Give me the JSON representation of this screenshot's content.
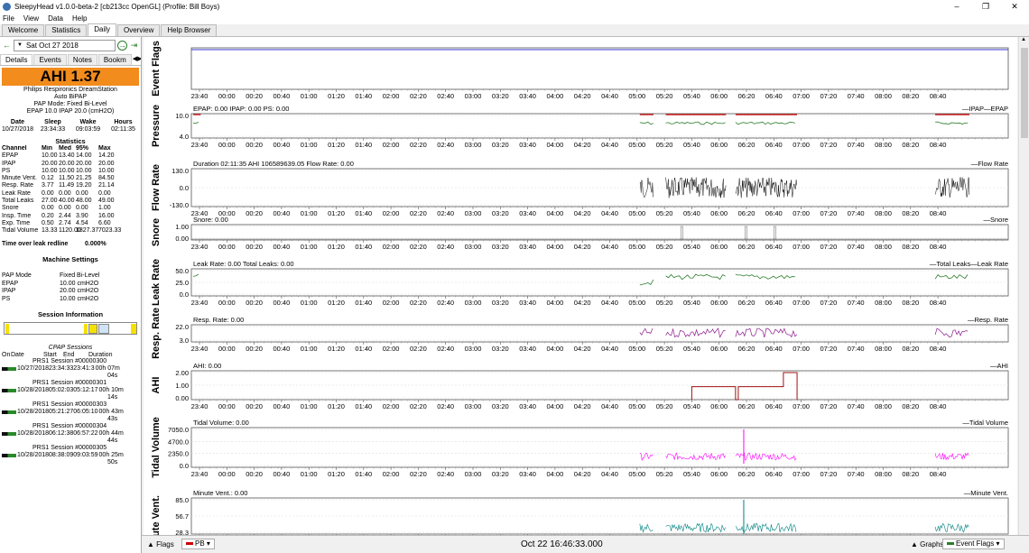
{
  "window": {
    "title": "SleepyHead v1.0.0-beta-2 [cb213cc OpenGL] (Profile: Bill Boys)",
    "minimize": "–",
    "maximize": "❐",
    "close": "✕"
  },
  "menu": [
    "File",
    "View",
    "Data",
    "Help"
  ],
  "tabs": [
    {
      "label": "Welcome",
      "active": false
    },
    {
      "label": "Statistics",
      "active": false
    },
    {
      "label": "Daily",
      "active": true
    },
    {
      "label": "Overview",
      "active": false
    },
    {
      "label": "Help Browser",
      "active": false
    }
  ],
  "left": {
    "date": "Sat Oct 27 2018",
    "subtabs": [
      "Details",
      "Events",
      "Notes",
      "Bookm"
    ],
    "ahi": "AHI 1.37",
    "machine": [
      "Philips Respironics DreamStation",
      "Auto BiPAP",
      "PAP Mode: Fixed Bi-Level",
      "EPAP 10.0 IPAP 20.0 (cmH2O)"
    ],
    "times": {
      "headers": [
        "Date",
        "Sleep",
        "Wake",
        "Hours"
      ],
      "values": [
        "10/27/2018",
        "23:34:33",
        "09:03:59",
        "02:11:35"
      ]
    },
    "stats_title": "Statistics",
    "stats_headers": [
      "Channel",
      "Min",
      "Med",
      "95%",
      "Max"
    ],
    "stats": [
      [
        "EPAP",
        "10.00",
        "13.40",
        "14.00",
        "14.20"
      ],
      [
        "IPAP",
        "20.00",
        "20.00",
        "20.00",
        "20.00"
      ],
      [
        "PS",
        "10.00",
        "10.00",
        "10.00",
        "10.00"
      ],
      [
        "Minute Vent.",
        "0.12",
        "11.50",
        "21.25",
        "84.50"
      ],
      [
        "Resp. Rate",
        "3.77",
        "11.49",
        "19.20",
        "21.14"
      ],
      [
        "Leak Rate",
        "0.00",
        "0.00",
        "0.00",
        "0.00"
      ],
      [
        "Total Leaks",
        "27.00",
        "40.00",
        "48.00",
        "49.00"
      ],
      [
        "Snore",
        "0.00",
        "0.00",
        "0.00",
        "1.00"
      ],
      [
        "Insp. Time",
        "0.20",
        "2.44",
        "3.90",
        "16.00"
      ],
      [
        "Exp. Time",
        "0.50",
        "2.74",
        "4.54",
        "6.60"
      ],
      [
        "Tidal Volume",
        "13.33",
        "1120.00",
        "1827.37",
        "7023.33"
      ]
    ],
    "leak_label": "Time over leak redline",
    "leak_value": "0.000%",
    "machine_settings_title": "Machine Settings",
    "settings": [
      [
        "PAP Mode",
        "Fixed Bi-Level"
      ],
      [
        "EPAP",
        "10.00 cmH2O"
      ],
      [
        "IPAP",
        "20.00 cmH2O"
      ],
      [
        "PS",
        "10.00 cmH2O"
      ]
    ],
    "session_info_title": "Session Information",
    "sessions_title": "CPAP Sessions",
    "sessions_headers": [
      "On",
      "Date",
      "Start",
      "End",
      "Duration"
    ],
    "sessions": [
      {
        "name": "PRS1 Session #00000300",
        "line": "10/27/201823:34:3323:41:3",
        "dur": "00h 07m",
        "dur2": "04s"
      },
      {
        "name": "PRS1 Session #00000301",
        "line": "10/28/201805:02:0305:12:17",
        "dur": "00h 10m",
        "dur2": "14s"
      },
      {
        "name": "PRS1 Session #00000303",
        "line": "10/28/201805:21:2706:05:10",
        "dur": "00h 43m",
        "dur2": "43s"
      },
      {
        "name": "PRS1 Session #00000304",
        "line": "10/28/201806:12:3806:57:22",
        "dur": "00h 44m",
        "dur2": "44s"
      },
      {
        "name": "PRS1 Session #00000305",
        "line": "10/28/201808:38:0909:03:59",
        "dur": "00h 25m",
        "dur2": "50s"
      }
    ]
  },
  "bottom": {
    "flags": "Flags",
    "pb": "PB",
    "time": "Oct 22 16:46:33.000",
    "graphs": "Graphs",
    "event_flags": "Event Flags"
  },
  "colors": {
    "ahi_box": "#f28c1c",
    "flow": "#000000",
    "leak": "#2a7d2a",
    "resp": "#8b1a8b",
    "ahi": "#a01010",
    "tidal": "#ff00ff",
    "minvent": "#008080",
    "epap": "#2a7d2a",
    "ipap": "#cc0000"
  },
  "chart_data": [
    {
      "type": "line",
      "ylabel": "Event Flags",
      "title": "",
      "x": [
        "23:40",
        "00:00",
        "00:20",
        "00:40",
        "01:00",
        "01:20",
        "01:40",
        "02:00",
        "02:20",
        "02:40",
        "03:00",
        "03:20",
        "03:40",
        "04:00",
        "04:20",
        "04:40",
        "05:00",
        "05:20",
        "05:40",
        "06:00",
        "06:20",
        "06:40",
        "07:00",
        "07:20",
        "07:40",
        "08:00",
        "08:20",
        "08:40"
      ],
      "yticks": [],
      "legend": []
    },
    {
      "type": "line",
      "ylabel": "Pressure",
      "title": "EPAP: 0.00 IPAP: 0.00 PS: 0.00",
      "yticks": [
        "10.0",
        "4.0"
      ],
      "legend": [
        "IPAP",
        "EPAP"
      ]
    },
    {
      "type": "line",
      "ylabel": "Flow Rate",
      "title": "Duration 02:11:35 AHI 106589639.05 Flow Rate: 0.00",
      "yticks": [
        "130.0",
        "0.0",
        "-130.0"
      ],
      "legend": [
        "Flow Rate"
      ]
    },
    {
      "type": "line",
      "ylabel": "Snore",
      "title": "Snore: 0.00",
      "yticks": [
        "1.00",
        "0.00"
      ],
      "legend": [
        "Snore"
      ]
    },
    {
      "type": "line",
      "ylabel": "Leak Rate",
      "title": "Leak Rate: 0.00 Total Leaks: 0.00",
      "yticks": [
        "50.0",
        "25.0",
        "0.0"
      ],
      "legend": [
        "Total Leaks",
        "Leak Rate"
      ]
    },
    {
      "type": "line",
      "ylabel": "Resp. Rate",
      "title": "Resp. Rate: 0.00",
      "yticks": [
        "22.0",
        "3.0"
      ],
      "legend": [
        "Resp. Rate"
      ]
    },
    {
      "type": "line",
      "ylabel": "AHI",
      "title": "AHI: 0.00",
      "yticks": [
        "2.00",
        "1.00",
        "0.00"
      ],
      "legend": [
        "AHI"
      ]
    },
    {
      "type": "line",
      "ylabel": "Tidal Volume",
      "title": "Tidal Volume: 0.00",
      "yticks": [
        "7050.0",
        "4700.0",
        "2350.0",
        "0.0"
      ],
      "legend": [
        "Tidal Volume"
      ]
    },
    {
      "type": "line",
      "ylabel": "ute Vent.",
      "title": "Minute Vent.: 0.00",
      "yticks": [
        "85.0",
        "56.7",
        "28.3"
      ],
      "legend": [
        "Minute Vent."
      ]
    }
  ]
}
